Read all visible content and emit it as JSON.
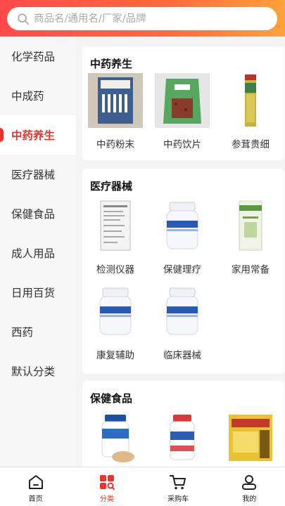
{
  "search": {
    "placeholder": "商品名/通用名/厂家/品牌"
  },
  "sidebar": {
    "items": [
      {
        "label": "化学药品"
      },
      {
        "label": "中成药"
      },
      {
        "label": "中药养生"
      },
      {
        "label": "医疗器械"
      },
      {
        "label": "保健食品"
      },
      {
        "label": "成人用品"
      },
      {
        "label": "日用百货"
      },
      {
        "label": "西药"
      },
      {
        "label": "默认分类"
      }
    ],
    "active_index": 2
  },
  "sections": [
    {
      "title": "中药养生",
      "items": [
        {
          "label": "中药粉末"
        },
        {
          "label": "中药饮片"
        },
        {
          "label": "参茸贵细"
        }
      ]
    },
    {
      "title": "医疗器械",
      "items": [
        {
          "label": "检测仪器"
        },
        {
          "label": "保健理疗"
        },
        {
          "label": "家用常备"
        },
        {
          "label": "康复辅助"
        },
        {
          "label": "临床器械"
        }
      ]
    },
    {
      "title": "保健食品",
      "items": [
        {
          "label": ""
        },
        {
          "label": ""
        },
        {
          "label": ""
        }
      ]
    }
  ],
  "tabbar": {
    "items": [
      {
        "label": "首页",
        "icon": "home-icon"
      },
      {
        "label": "分类",
        "icon": "category-icon"
      },
      {
        "label": "采购车",
        "icon": "cart-icon"
      },
      {
        "label": "我的",
        "icon": "profile-icon"
      }
    ],
    "active_index": 1
  },
  "colors": {
    "accent": "#e8352b",
    "header_start": "#ff4a4a",
    "header_end": "#ffa23a"
  }
}
